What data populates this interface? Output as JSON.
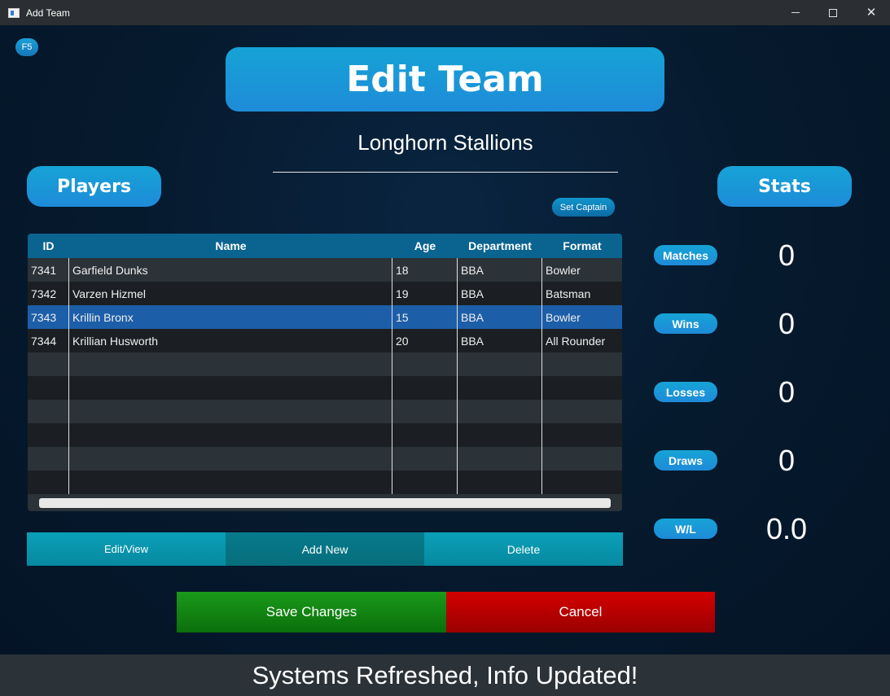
{
  "window": {
    "title": "Add Team"
  },
  "refresh_button": {
    "label": "F5"
  },
  "hero": {
    "title": "Edit Team"
  },
  "team": {
    "name": "Longhorn Stallions"
  },
  "players_header": "Players",
  "stats_header": "Stats",
  "set_captain_label": "Set Captain",
  "table": {
    "columns": [
      "ID",
      "Name",
      "Age",
      "Department",
      "Format"
    ],
    "rows": [
      {
        "id": "7341",
        "name": "Garfield Dunks",
        "age": "18",
        "department": "BBA",
        "format": "Bowler"
      },
      {
        "id": "7342",
        "name": "Varzen Hizmel",
        "age": "19",
        "department": "BBA",
        "format": "Batsman"
      },
      {
        "id": "7343",
        "name": "Krillin Bronx",
        "age": "15",
        "department": "BBA",
        "format": "Bowler"
      },
      {
        "id": "7344",
        "name": "Krillian Husworth",
        "age": "20",
        "department": "BBA",
        "format": "All Rounder"
      }
    ],
    "selected_row": 2
  },
  "actions": {
    "edit": "Edit/View",
    "add": "Add New",
    "delete": "Delete"
  },
  "footer_buttons": {
    "save": "Save Changes",
    "cancel": "Cancel"
  },
  "stats": [
    {
      "label": "Matches",
      "value": "0"
    },
    {
      "label": "Wins",
      "value": "0"
    },
    {
      "label": "Losses",
      "value": "0"
    },
    {
      "label": "Draws",
      "value": "0"
    },
    {
      "label": "W/L",
      "value": "0.0"
    }
  ],
  "status_message": "Systems Refreshed, Info Updated!",
  "colors": {
    "accent": "#1e8bd8",
    "header_row": "#0b6390",
    "selected_row": "#1d5ea8",
    "save": "#0b8a0b",
    "cancel": "#c00000"
  }
}
